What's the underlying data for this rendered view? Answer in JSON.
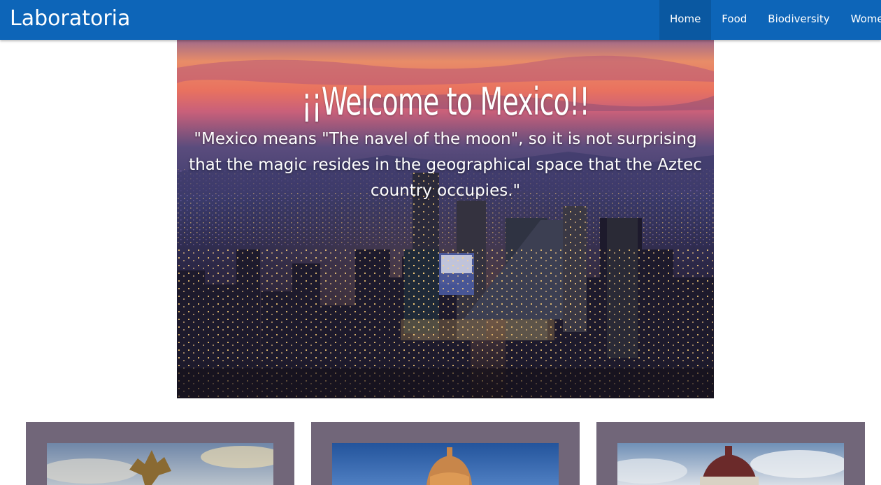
{
  "navbar": {
    "brand": "Laboratoria",
    "items": [
      {
        "label": "Home",
        "active": true
      },
      {
        "label": "Food",
        "active": false
      },
      {
        "label": "Biodiversity",
        "active": false
      },
      {
        "label": "Women",
        "active": false
      }
    ]
  },
  "hero": {
    "title": "¡¡Welcome to Mexico!!",
    "quote": "\"Mexico means \"The navel of the moon\", so it is not surprising that the magic resides in the geographical space that the Aztec country occupies.\""
  },
  "cards": [
    {
      "image": "angel-of-independence-photo"
    },
    {
      "image": "palacio-bellas-artes-dome-photo"
    },
    {
      "image": "palacio-postal-dome-photo"
    }
  ],
  "colors": {
    "navbar": "#0d65b8",
    "navbar_active": "#0a58a1",
    "card_frame": "#716679"
  }
}
